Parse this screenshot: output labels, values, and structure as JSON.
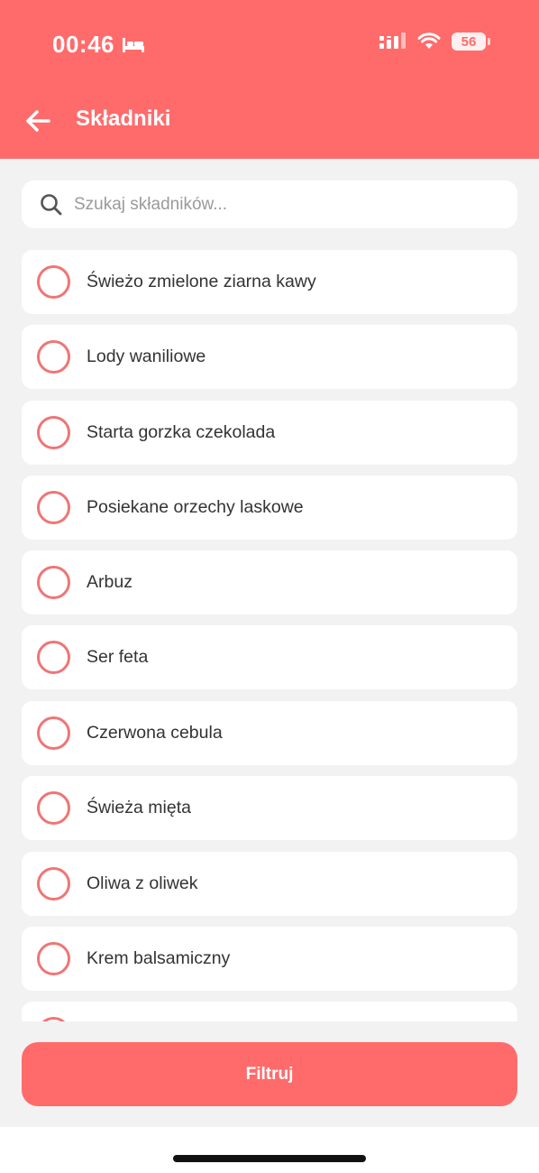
{
  "status_bar": {
    "time": "00:46",
    "battery": "56"
  },
  "header": {
    "title": "Składniki"
  },
  "search": {
    "placeholder": "Szukaj składników...",
    "value": ""
  },
  "ingredients": [
    {
      "label": "Świeżo zmielone ziarna kawy",
      "selected": false
    },
    {
      "label": "Lody waniliowe",
      "selected": false
    },
    {
      "label": "Starta gorzka czekolada",
      "selected": false
    },
    {
      "label": "Posiekane orzechy laskowe",
      "selected": false
    },
    {
      "label": "Arbuz",
      "selected": false
    },
    {
      "label": "Ser feta",
      "selected": false
    },
    {
      "label": "Czerwona cebula",
      "selected": false
    },
    {
      "label": "Świeża mięta",
      "selected": false
    },
    {
      "label": "Oliwa z oliwek",
      "selected": false
    },
    {
      "label": "Krem balsamiczny",
      "selected": false
    },
    {
      "label": "",
      "selected": false
    }
  ],
  "filter_button": {
    "label": "Filtruj"
  },
  "colors": {
    "accent": "#ff6b6b",
    "radio_border": "#f07575",
    "background": "#f2f2f2"
  }
}
